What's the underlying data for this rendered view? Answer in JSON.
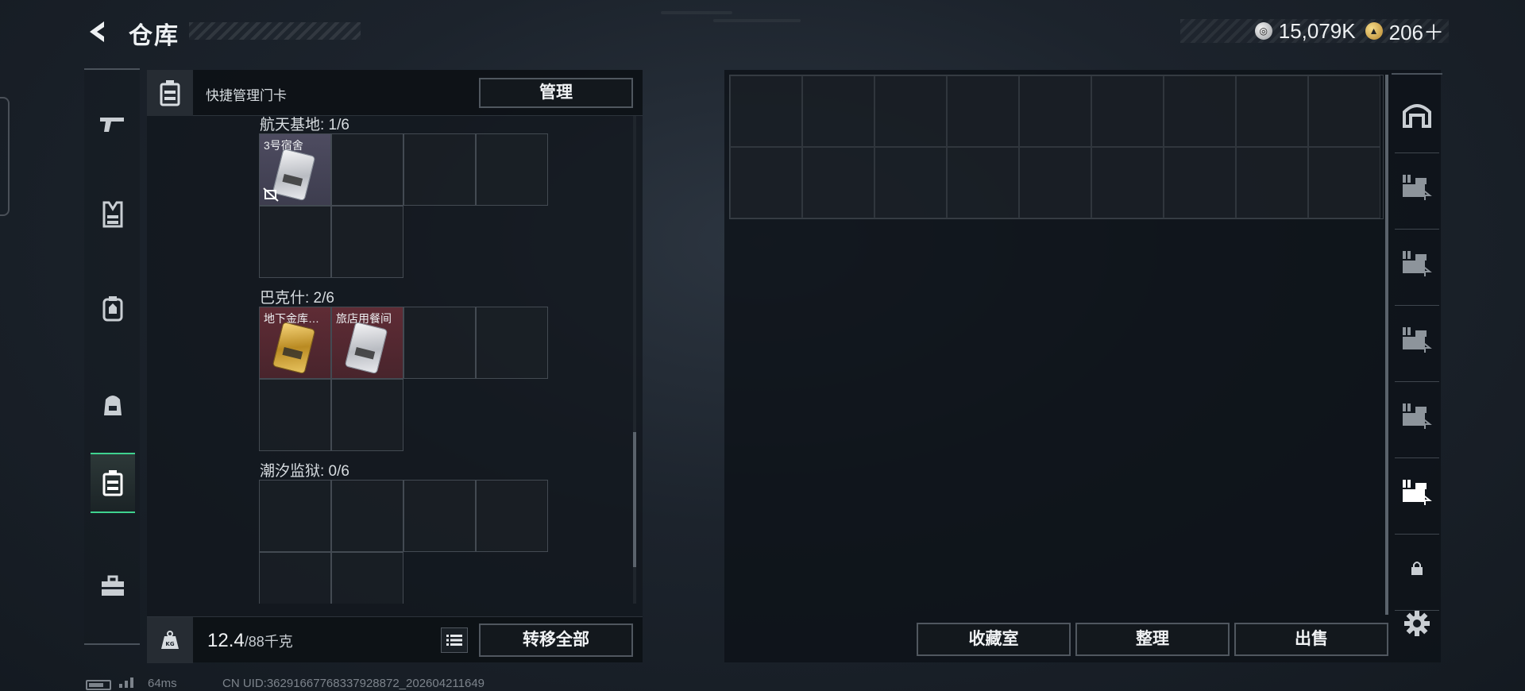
{
  "header": {
    "title": "仓库",
    "currencies": [
      {
        "icon": "silver-coin-icon",
        "amount": "15,079K"
      },
      {
        "icon": "gold-coin-icon",
        "amount": "206＋"
      }
    ]
  },
  "left_rail": {
    "items": [
      {
        "icon": "pistol-icon",
        "active": false
      },
      {
        "icon": "vest-icon",
        "active": false
      },
      {
        "icon": "backpack-armor-icon",
        "active": false
      },
      {
        "icon": "backpack-icon",
        "active": false
      },
      {
        "icon": "keycard-case-icon",
        "active": true
      },
      {
        "icon": "toolbox-icon",
        "active": false
      }
    ]
  },
  "storage_panel": {
    "title": "快捷管理门卡",
    "manage_label": "管理",
    "sections": [
      {
        "label": "航天基地: 1/6",
        "items": [
          {
            "label": "3号宿舍",
            "rarity": "lavender",
            "card": "silver",
            "no_sell": true
          }
        ]
      },
      {
        "label": "巴克什: 2/6",
        "items": [
          {
            "label": "地下金库…",
            "rarity": "pink",
            "card": "gold",
            "no_sell": false
          },
          {
            "label": "旅店用餐间",
            "rarity": "pink",
            "card": "silver",
            "no_sell": false
          }
        ]
      },
      {
        "label": "潮汐监狱: 0/6",
        "items": []
      }
    ],
    "weight": {
      "current": "12.4",
      "max": "/88千克"
    },
    "transfer_all_label": "转移全部"
  },
  "container_panel": {
    "rows": 2,
    "cols": 9,
    "buttons": [
      "收藏室",
      "整理",
      "出售"
    ]
  },
  "right_rail": {
    "items": [
      {
        "icon": "storage-home-icon"
      },
      {
        "icon": "stash-tab-1-icon"
      },
      {
        "icon": "stash-tab-2-icon"
      },
      {
        "icon": "stash-tab-3-icon"
      },
      {
        "icon": "stash-tab-4-icon"
      },
      {
        "icon": "stash-tab-5-active-icon"
      },
      {
        "icon": "lock-icon"
      },
      {
        "icon": "settings-gear-icon"
      }
    ]
  },
  "status_bar": {
    "ping": "64ms",
    "uid": "CN UID:36291667768337928872_202604211649"
  },
  "colors": {
    "active_accent": "#3fd28f",
    "rarity_pink": "#7a3240",
    "rarity_lavender": "#5c5870"
  }
}
